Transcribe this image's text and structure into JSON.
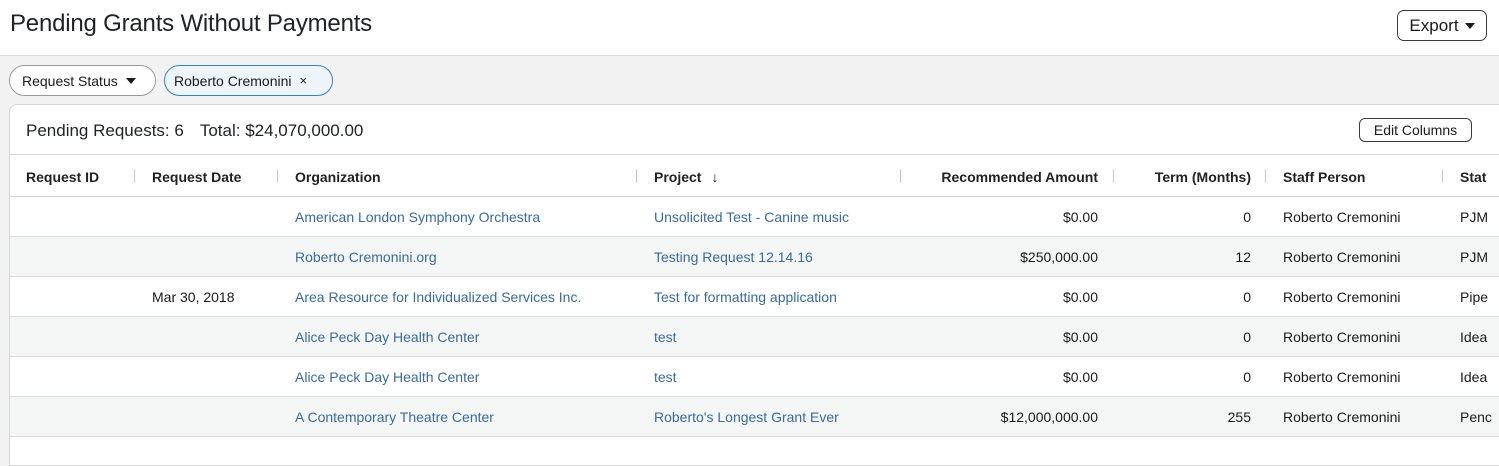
{
  "header": {
    "title": "Pending Grants Without Payments",
    "export_label": "Export"
  },
  "filters": {
    "status_label": "Request Status",
    "person_label": "Roberto Cremonini",
    "remove_icon": "×"
  },
  "summary": {
    "pending": "Pending Requests: 6",
    "total": "Total: $24,070,000.00",
    "edit_columns": "Edit Columns"
  },
  "columns": {
    "request_id": "Request ID",
    "request_date": "Request Date",
    "organization": "Organization",
    "project": "Project",
    "sort_icon": "↓",
    "recommended_amount": "Recommended Amount",
    "term": "Term (Months)",
    "staff_person": "Staff Person",
    "status": "Stat"
  },
  "rows": [
    {
      "request_id": "",
      "request_date": "",
      "organization": "American London Symphony Orchestra",
      "project": "Unsolicited Test - Canine music",
      "amount": "$0.00",
      "term": "0",
      "staff": "Roberto Cremonini",
      "status": "PJM"
    },
    {
      "request_id": "",
      "request_date": "",
      "organization": "Roberto Cremonini.org",
      "project": "Testing Request 12.14.16",
      "amount": "$250,000.00",
      "term": "12",
      "staff": "Roberto Cremonini",
      "status": "PJM"
    },
    {
      "request_id": "",
      "request_date": "Mar 30, 2018",
      "organization": "Area Resource for Individualized Services Inc.",
      "project": "Test for formatting application",
      "amount": "$0.00",
      "term": "0",
      "staff": "Roberto Cremonini",
      "status": "Pipe"
    },
    {
      "request_id": "",
      "request_date": "",
      "organization": "Alice Peck Day Health Center",
      "project": "test",
      "amount": "$0.00",
      "term": "0",
      "staff": "Roberto Cremonini",
      "status": "Idea"
    },
    {
      "request_id": "",
      "request_date": "",
      "organization": "Alice Peck Day Health Center",
      "project": "test",
      "amount": "$0.00",
      "term": "0",
      "staff": "Roberto Cremonini",
      "status": "Idea"
    },
    {
      "request_id": "",
      "request_date": "",
      "organization": "A Contemporary Theatre Center",
      "project": "Roberto's Longest Grant Ever",
      "amount": "$12,000,000.00",
      "term": "255",
      "staff": "Roberto Cremonini",
      "status": "Penc"
    }
  ]
}
